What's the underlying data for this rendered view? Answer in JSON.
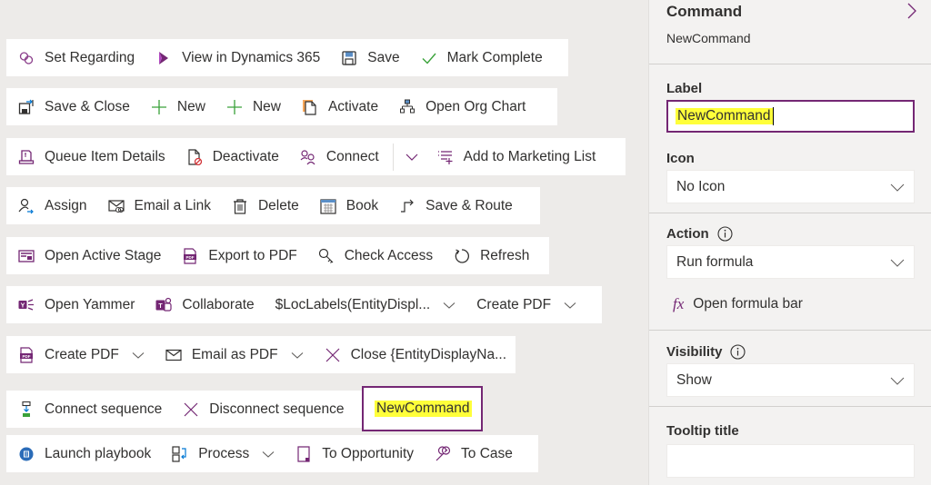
{
  "command_bars": [
    {
      "items": [
        {
          "label": "Set Regarding",
          "icon": "link-icon"
        },
        {
          "label": "View in Dynamics 365",
          "icon": "dynamics-icon"
        },
        {
          "label": "Save",
          "icon": "save-icon"
        },
        {
          "label": "Mark Complete",
          "icon": "checkmark-icon"
        }
      ]
    },
    {
      "items": [
        {
          "label": "Save & Close",
          "icon": "save-close-icon"
        },
        {
          "label": "New",
          "icon": "plus-icon"
        },
        {
          "label": "New",
          "icon": "plus-icon"
        },
        {
          "label": "Activate",
          "icon": "activate-icon"
        },
        {
          "label": "Open Org Chart",
          "icon": "org-chart-icon"
        }
      ]
    },
    {
      "items": [
        {
          "label": "Queue Item Details",
          "icon": "queue-icon"
        },
        {
          "label": "Deactivate",
          "icon": "deactivate-icon"
        },
        {
          "label": "Connect",
          "icon": "connect-icon"
        },
        {
          "label": "Add to Marketing List",
          "icon": "add-list-icon"
        }
      ]
    },
    {
      "items": [
        {
          "label": "Assign",
          "icon": "assign-icon"
        },
        {
          "label": "Email a Link",
          "icon": "email-link-icon"
        },
        {
          "label": "Delete",
          "icon": "delete-icon"
        },
        {
          "label": "Book",
          "icon": "calendar-icon"
        },
        {
          "label": "Save & Route",
          "icon": "route-icon"
        }
      ]
    },
    {
      "items": [
        {
          "label": "Open Active Stage",
          "icon": "stage-icon"
        },
        {
          "label": "Export to PDF",
          "icon": "pdf-icon"
        },
        {
          "label": "Check Access",
          "icon": "key-icon"
        },
        {
          "label": "Refresh",
          "icon": "refresh-icon"
        }
      ]
    },
    {
      "items": [
        {
          "label": "Open Yammer",
          "icon": "yammer-icon"
        },
        {
          "label": "Collaborate",
          "icon": "teams-icon"
        },
        {
          "label": "$LocLabels(EntityDispl...",
          "icon": ""
        },
        {
          "label": "Create PDF",
          "icon": ""
        }
      ]
    },
    {
      "items": [
        {
          "label": "Create PDF",
          "icon": "pdf-icon"
        },
        {
          "label": "Email as PDF",
          "icon": "mail-icon"
        },
        {
          "label": "Close {EntityDisplayNa...",
          "icon": "close-icon"
        }
      ]
    },
    {
      "items": [
        {
          "label": "Connect sequence",
          "icon": "connect-sequence-icon"
        },
        {
          "label": "Disconnect sequence",
          "icon": "close-icon"
        }
      ]
    },
    {
      "items": [
        {
          "label": "Launch playbook",
          "icon": "playbook-icon"
        },
        {
          "label": "Process",
          "icon": "process-icon"
        },
        {
          "label": "To Opportunity",
          "icon": "opportunity-icon"
        },
        {
          "label": "To Case",
          "icon": "wrench-icon"
        }
      ]
    }
  ],
  "selected_command": {
    "label": "NewCommand"
  },
  "panel": {
    "title": "Command",
    "subtitle": "NewCommand",
    "label_field": {
      "label": "Label",
      "value": "NewCommand"
    },
    "icon_field": {
      "label": "Icon",
      "value": "No Icon"
    },
    "action_field": {
      "label": "Action",
      "value": "Run formula",
      "formula_link": "Open formula bar"
    },
    "visibility_field": {
      "label": "Visibility",
      "value": "Show"
    },
    "tooltip_title_field": {
      "label": "Tooltip title"
    }
  },
  "colors": {
    "accent": "#742774",
    "highlight": "#ffff3a",
    "green": "#107c10"
  }
}
